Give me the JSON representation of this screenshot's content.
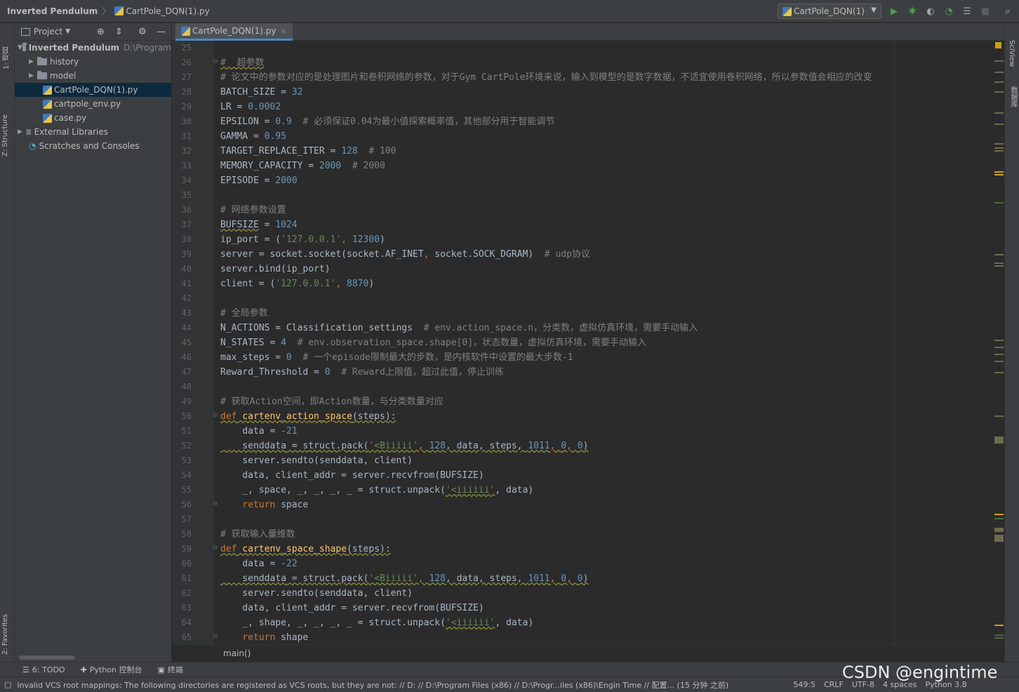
{
  "title": {
    "project": "Inverted Pendulum",
    "file": "CartPole_DQN(1).py"
  },
  "run_config": "CartPole_DQN(1)",
  "colors": {
    "run": "#499c54",
    "debug": "#499c54",
    "bg": "#2b2b2b",
    "panel": "#3c3f41"
  },
  "toolbar_icons": [
    "run-icon",
    "debug-icon",
    "coverage-icon",
    "profile-icon",
    "build-icon",
    "stop-icon",
    "search-icon"
  ],
  "left_tabs": {
    "project": "1: 项目",
    "structure": "Z: Structure",
    "favorites": "2: Favorites"
  },
  "right_tabs": {
    "sciview": "SciView",
    "database": "数据库"
  },
  "project_panel": {
    "header": "Project"
  },
  "tree": [
    {
      "label": "Inverted Pendulum",
      "path": "D:\\Program",
      "type": "root"
    },
    {
      "label": "history",
      "type": "folder"
    },
    {
      "label": "model",
      "type": "folder"
    },
    {
      "label": "CartPole_DQN(1).py",
      "type": "py",
      "selected": true
    },
    {
      "label": "cartpole_env.py",
      "type": "py"
    },
    {
      "label": "case.py",
      "type": "py"
    },
    {
      "label": "External Libraries",
      "type": "lib"
    },
    {
      "label": "Scratches and Consoles",
      "type": "scratch"
    }
  ],
  "editor_tab": "CartPole_DQN(1).py",
  "line_numbers": [
    "25",
    "26",
    "27",
    "28",
    "29",
    "30",
    "31",
    "32",
    "33",
    "34",
    "35",
    "36",
    "37",
    "38",
    "39",
    "40",
    "41",
    "42",
    "43",
    "44",
    "45",
    "46",
    "47",
    "48",
    "49",
    "50",
    "51",
    "52",
    "53",
    "54",
    "55",
    "56",
    "57",
    "58",
    "59",
    "60",
    "61",
    "62",
    "63",
    "64",
    "65"
  ],
  "code": {
    "l26": "#  超参数",
    "l27": "# 论文中的参数对应的是处理图片和卷积网络的参数，对于Gym CartPole环境来说，输入到模型的是数字数据，不适宜使用卷积网络，所以参数值会相应的改变",
    "l28a": "BATCH_SIZE = ",
    "l28b": "32",
    "l29a": "LR = ",
    "l29b": "0.0002",
    "l30a": "EPSILON = ",
    "l30b": "0.9",
    "l30c": "  # 必须保证0.04为最小值探索概率值，其他部分用于智能调节",
    "l31a": "GAMMA = ",
    "l31b": "0.95",
    "l32a": "TARGET_REPLACE_ITER = ",
    "l32b": "128",
    "l32c": "  # 100",
    "l33a": "MEMORY_CAPACITY = ",
    "l33b": "2000",
    "l33c": "  # 2000",
    "l34a": "EPISODE = ",
    "l34b": "2000",
    "l36": "# 网络参数设置",
    "l37a": "BUFSIZE",
    "l37b": " = ",
    "l37c": "1024",
    "l38a": "ip_port = (",
    "l38b": "'127.0.0.1'",
    "l38c": ", ",
    "l38d": "12300",
    "l38e": ")",
    "l39a": "server = socket.socket(socket.AF_INET",
    "l39b": ", ",
    "l39c": "socket.SOCK_DGRAM)",
    "l39d": "  # udp协议",
    "l40": "server.bind(ip_port)",
    "l41a": "client = (",
    "l41b": "'127.0.0.1'",
    "l41c": ", ",
    "l41d": "8870",
    "l41e": ")",
    "l43": "# 全局参数",
    "l44a": "N_ACTIONS = Classification_settings",
    "l44b": "  # env.action_space.n，分类数，虚拟仿真环境，需要手动输入",
    "l45a": "N_STATES = ",
    "l45b": "4",
    "l45c": "  # env.observation_space.shape[0]，状态数量，虚拟仿真环境，需要手动输入",
    "l46a": "max_steps = ",
    "l46b": "0",
    "l46c": "  # 一个episode限制最大的步数，是内核软件中设置的最大步数-1",
    "l47a": "Reward_Threshold = ",
    "l47b": "0",
    "l47c": "  # Reward上限值，超过此值，停止训练",
    "l49": "# 获取Action空间，即Action数量，与分类数量对应",
    "l50a": "def",
    "l50b": " cartenv_action_space",
    "l50c": "(steps):",
    "l51a": "    data = ",
    "l51b": "-21",
    "l52a": "    senddata",
    "l52b": " = struct.pack(",
    "l52c": "'<Biiiii'",
    "l52d": ", ",
    "l52e": "128",
    "l52f": ", data, steps, ",
    "l52g": "1011",
    "l52h": ", ",
    "l52i": "0",
    "l52j": ", ",
    "l52k": "0",
    "l52l": ")",
    "l53": "    server.sendto(senddata, client)",
    "l54": "    data, client_addr = server.recvfrom(BUFSIZE)",
    "l55a": "    _, space, _, _, _, _ = struct.unpack(",
    "l55b": "'<iiiiii'",
    "l55c": ", data)",
    "l56a": "    return",
    "l56b": " space",
    "l58": "# 获取输入量维数",
    "l59a": "def",
    "l59b": " cartenv_space_shape",
    "l59c": "(steps):",
    "l60a": "    data = ",
    "l60b": "-22",
    "l61a": "    senddata",
    "l61b": " = struct.pack(",
    "l61c": "'<Biiiii'",
    "l61d": ", ",
    "l61e": "128",
    "l61f": ", data, steps, ",
    "l61g": "1011",
    "l61h": ", ",
    "l61i": "0",
    "l61j": ", ",
    "l61k": "0",
    "l61l": ")",
    "l62": "    server.sendto(senddata, client)",
    "l63": "    data, client_addr = server.recvfrom(BUFSIZE)",
    "l64a": "    _, shape, _, _, _, _ = struct.unpack(",
    "l64b": "'<iiiiii'",
    "l64c": ", data)",
    "l65a": "    return",
    "l65b": " shape"
  },
  "breadcrumb": "main()",
  "bottom_tools": {
    "todo": "6: TODO",
    "console": "Python 控制台",
    "terminal": "终端"
  },
  "status": {
    "message": "Invalid VCS root mappings: The following directories are registered as VCS roots, but they are not: // D: // D:\\Program Files (x86) // D:\\Progr...iles (x86)\\Engin Time // 配置... (15 分钟 之前)",
    "position": "549:5",
    "line_sep": "CRLF",
    "encoding": "UTF-8",
    "indent": "4 spaces",
    "interpreter": "Python 3.8"
  },
  "watermark": "CSDN @engintime"
}
